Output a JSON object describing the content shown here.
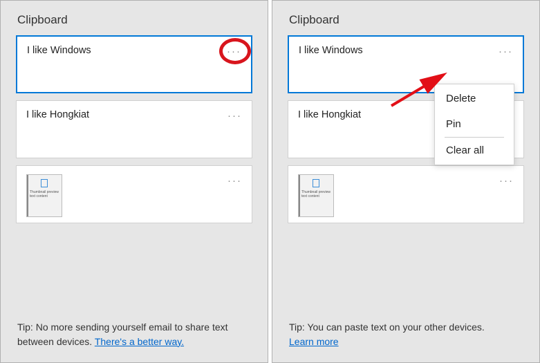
{
  "left_panel": {
    "title": "Clipboard",
    "items": [
      {
        "text": "I like Windows"
      },
      {
        "text": "I like Hongkiat"
      },
      {
        "image": true
      }
    ],
    "tip_prefix": "Tip: No more sending yourself email to share text between devices.  ",
    "tip_link": "There's a better way."
  },
  "right_panel": {
    "title": "Clipboard",
    "items": [
      {
        "text": "I like Windows"
      },
      {
        "text": "I like Hongkiat"
      },
      {
        "image": true
      }
    ],
    "tip_prefix": "Tip: You can paste text on your other devices.",
    "tip_link": "Learn more"
  },
  "context_menu": {
    "delete": "Delete",
    "pin": "Pin",
    "clear": "Clear all"
  }
}
